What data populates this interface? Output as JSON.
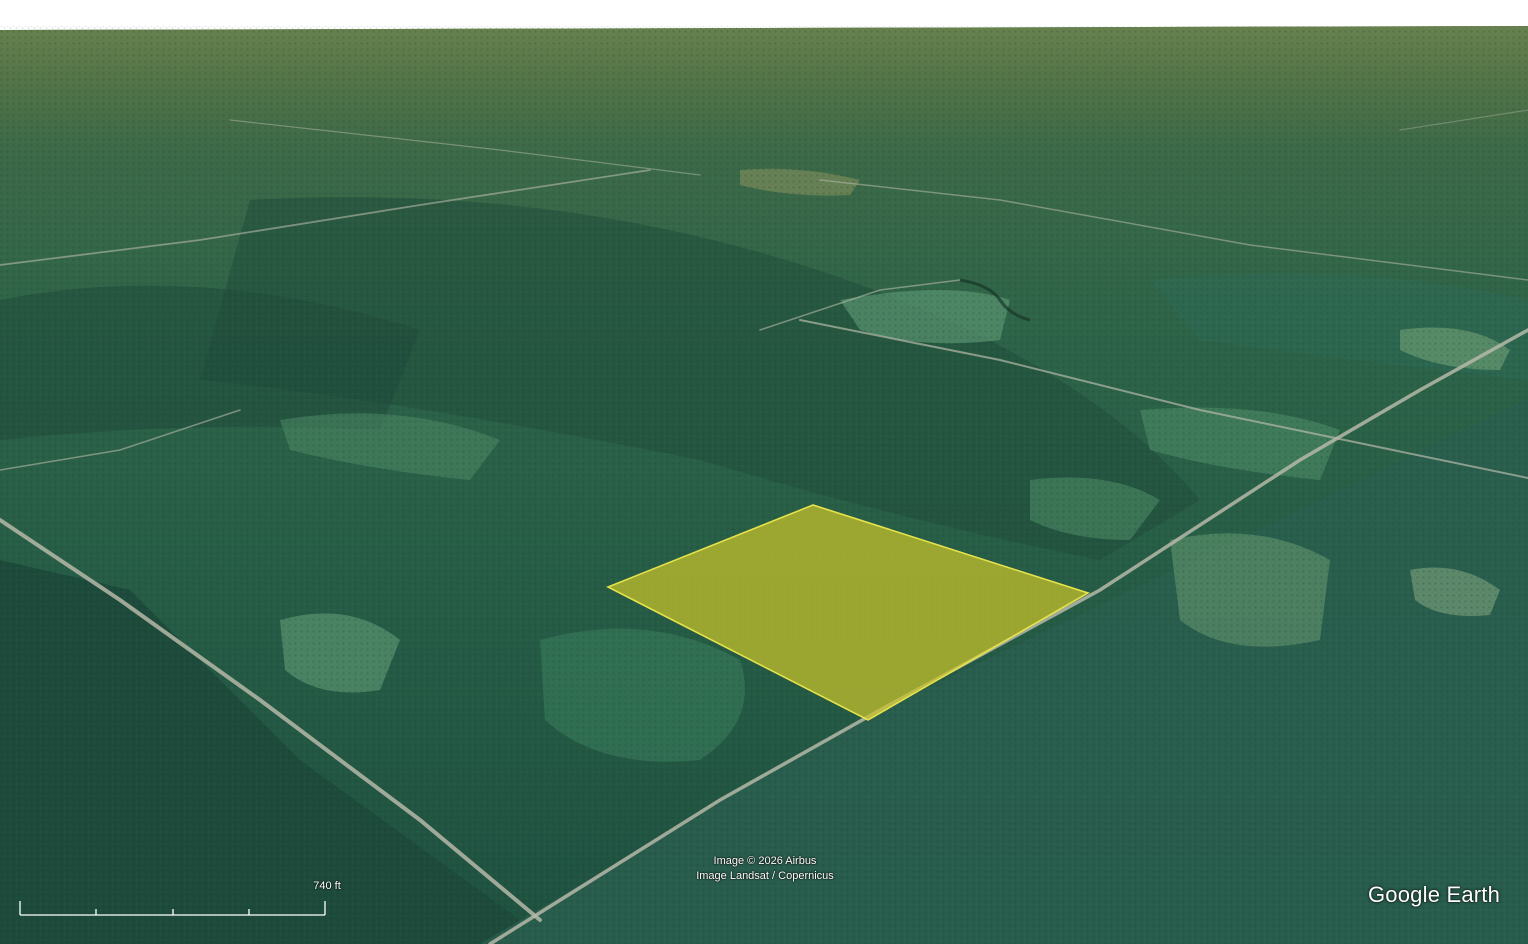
{
  "map": {
    "overlay_polygon": {
      "fill_color": "#c9c42a",
      "stroke_color": "#e6e24a",
      "fill_opacity": 0.72
    },
    "colors": {
      "sky": "#ffffff",
      "horizon_haze": "#53703f",
      "forest_dark": "#1f4a3a",
      "forest_mid": "#2e6a50",
      "clearing": "#4e8a63",
      "road": "#b6b9a8"
    }
  },
  "attribution": {
    "line1": "Image © 2026 Airbus",
    "line2": "Image Landsat / Copernicus"
  },
  "scale": {
    "label": "740 ft"
  },
  "logo": {
    "text": "Google Earth"
  }
}
